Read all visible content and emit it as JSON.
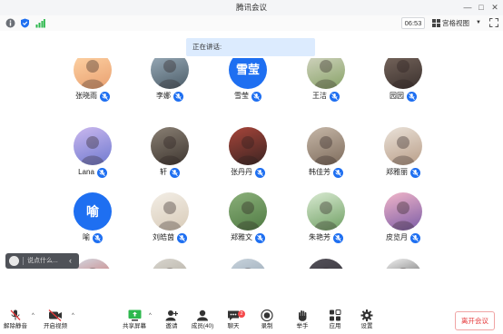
{
  "window": {
    "title": "腾讯会议"
  },
  "status": {
    "timer": "06:53",
    "view_label": "宫格视图"
  },
  "speaking_banner": "正在讲话:",
  "participants": [
    {
      "name": "张晓雨",
      "type": "photo",
      "muted": true,
      "colors": [
        "#ffd6a8",
        "#e9a070"
      ]
    },
    {
      "name": "李娜",
      "type": "photo",
      "muted": true,
      "colors": [
        "#9fb1bf",
        "#4c5d68"
      ]
    },
    {
      "name": "雪莹",
      "type": "text",
      "avatar_text": "雪莹",
      "muted": true
    },
    {
      "name": "王洁",
      "type": "photo",
      "muted": true,
      "colors": [
        "#d8d8c8",
        "#87a266"
      ]
    },
    {
      "name": "园园",
      "type": "photo",
      "muted": true,
      "colors": [
        "#7b6a60",
        "#3b312e"
      ]
    },
    {
      "name": "Lana",
      "type": "photo",
      "muted": true,
      "colors": [
        "#cbb8ee",
        "#6f7ad0"
      ]
    },
    {
      "name": "轩",
      "type": "photo",
      "muted": true,
      "colors": [
        "#8a8074",
        "#3e3630"
      ]
    },
    {
      "name": "张丹丹",
      "type": "photo",
      "muted": true,
      "colors": [
        "#a8453a",
        "#3a2422"
      ]
    },
    {
      "name": "韩佳芳",
      "type": "photo",
      "muted": true,
      "colors": [
        "#c6b7a8",
        "#7e6c5c"
      ]
    },
    {
      "name": "郑雅丽",
      "type": "photo",
      "muted": true,
      "colors": [
        "#eae2d9",
        "#b99e88"
      ]
    },
    {
      "name": "喻",
      "type": "text",
      "avatar_text": "喻",
      "muted": true
    },
    {
      "name": "刘皓茵",
      "type": "photo",
      "muted": true,
      "colors": [
        "#f3eee6",
        "#d8cbb8"
      ]
    },
    {
      "name": "郑雅文",
      "type": "photo",
      "muted": true,
      "colors": [
        "#8bb07a",
        "#4f7a43"
      ]
    },
    {
      "name": "朱艳芳",
      "type": "photo",
      "muted": true,
      "colors": [
        "#d9ead2",
        "#6f9f63"
      ]
    },
    {
      "name": "皮览月",
      "type": "photo",
      "muted": true,
      "colors": [
        "#f2b6c9",
        "#7b5ca6"
      ]
    },
    {
      "name": "",
      "type": "photo",
      "muted": false,
      "colors": [
        "#d3d8e2",
        "#c4524a"
      ]
    },
    {
      "name": "",
      "type": "photo",
      "muted": false,
      "colors": [
        "#d9d6cf",
        "#a59f92"
      ]
    },
    {
      "name": "",
      "type": "photo",
      "muted": false,
      "colors": [
        "#c9d4dd",
        "#8596a6"
      ]
    },
    {
      "name": "",
      "type": "photo",
      "muted": false,
      "colors": [
        "#55525a",
        "#2b2930"
      ]
    },
    {
      "name": "",
      "type": "photo",
      "muted": false,
      "colors": [
        "#f4f4f4",
        "#303030"
      ]
    }
  ],
  "chat": {
    "placeholder": "说点什么..."
  },
  "toolbar": {
    "mute": "解除静音",
    "video": "开启视频",
    "share": "共享屏幕",
    "invite": "邀请",
    "members": "成员(40)",
    "chat": "聊天",
    "chat_badge": "2",
    "record": "录制",
    "raise_hand": "举手",
    "apps": "应用",
    "settings": "设置",
    "leave": "离开会议"
  },
  "colors": {
    "accent": "#1e6ff1",
    "leave": "#e5393b",
    "banner": "#dcebfe"
  }
}
